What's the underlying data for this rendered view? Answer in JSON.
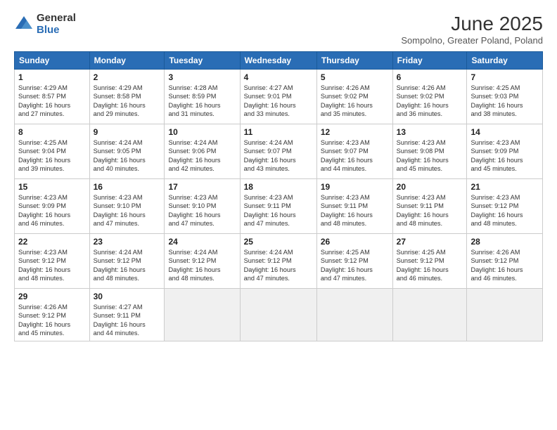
{
  "header": {
    "logo_general": "General",
    "logo_blue": "Blue",
    "month_year": "June 2025",
    "location": "Sompolno, Greater Poland, Poland"
  },
  "weekdays": [
    "Sunday",
    "Monday",
    "Tuesday",
    "Wednesday",
    "Thursday",
    "Friday",
    "Saturday"
  ],
  "weeks": [
    [
      {
        "day": "1",
        "info": "Sunrise: 4:29 AM\nSunset: 8:57 PM\nDaylight: 16 hours\nand 27 minutes."
      },
      {
        "day": "2",
        "info": "Sunrise: 4:29 AM\nSunset: 8:58 PM\nDaylight: 16 hours\nand 29 minutes."
      },
      {
        "day": "3",
        "info": "Sunrise: 4:28 AM\nSunset: 8:59 PM\nDaylight: 16 hours\nand 31 minutes."
      },
      {
        "day": "4",
        "info": "Sunrise: 4:27 AM\nSunset: 9:01 PM\nDaylight: 16 hours\nand 33 minutes."
      },
      {
        "day": "5",
        "info": "Sunrise: 4:26 AM\nSunset: 9:02 PM\nDaylight: 16 hours\nand 35 minutes."
      },
      {
        "day": "6",
        "info": "Sunrise: 4:26 AM\nSunset: 9:02 PM\nDaylight: 16 hours\nand 36 minutes."
      },
      {
        "day": "7",
        "info": "Sunrise: 4:25 AM\nSunset: 9:03 PM\nDaylight: 16 hours\nand 38 minutes."
      }
    ],
    [
      {
        "day": "8",
        "info": "Sunrise: 4:25 AM\nSunset: 9:04 PM\nDaylight: 16 hours\nand 39 minutes."
      },
      {
        "day": "9",
        "info": "Sunrise: 4:24 AM\nSunset: 9:05 PM\nDaylight: 16 hours\nand 40 minutes."
      },
      {
        "day": "10",
        "info": "Sunrise: 4:24 AM\nSunset: 9:06 PM\nDaylight: 16 hours\nand 42 minutes."
      },
      {
        "day": "11",
        "info": "Sunrise: 4:24 AM\nSunset: 9:07 PM\nDaylight: 16 hours\nand 43 minutes."
      },
      {
        "day": "12",
        "info": "Sunrise: 4:23 AM\nSunset: 9:07 PM\nDaylight: 16 hours\nand 44 minutes."
      },
      {
        "day": "13",
        "info": "Sunrise: 4:23 AM\nSunset: 9:08 PM\nDaylight: 16 hours\nand 45 minutes."
      },
      {
        "day": "14",
        "info": "Sunrise: 4:23 AM\nSunset: 9:09 PM\nDaylight: 16 hours\nand 45 minutes."
      }
    ],
    [
      {
        "day": "15",
        "info": "Sunrise: 4:23 AM\nSunset: 9:09 PM\nDaylight: 16 hours\nand 46 minutes."
      },
      {
        "day": "16",
        "info": "Sunrise: 4:23 AM\nSunset: 9:10 PM\nDaylight: 16 hours\nand 47 minutes."
      },
      {
        "day": "17",
        "info": "Sunrise: 4:23 AM\nSunset: 9:10 PM\nDaylight: 16 hours\nand 47 minutes."
      },
      {
        "day": "18",
        "info": "Sunrise: 4:23 AM\nSunset: 9:11 PM\nDaylight: 16 hours\nand 47 minutes."
      },
      {
        "day": "19",
        "info": "Sunrise: 4:23 AM\nSunset: 9:11 PM\nDaylight: 16 hours\nand 48 minutes."
      },
      {
        "day": "20",
        "info": "Sunrise: 4:23 AM\nSunset: 9:11 PM\nDaylight: 16 hours\nand 48 minutes."
      },
      {
        "day": "21",
        "info": "Sunrise: 4:23 AM\nSunset: 9:12 PM\nDaylight: 16 hours\nand 48 minutes."
      }
    ],
    [
      {
        "day": "22",
        "info": "Sunrise: 4:23 AM\nSunset: 9:12 PM\nDaylight: 16 hours\nand 48 minutes."
      },
      {
        "day": "23",
        "info": "Sunrise: 4:24 AM\nSunset: 9:12 PM\nDaylight: 16 hours\nand 48 minutes."
      },
      {
        "day": "24",
        "info": "Sunrise: 4:24 AM\nSunset: 9:12 PM\nDaylight: 16 hours\nand 48 minutes."
      },
      {
        "day": "25",
        "info": "Sunrise: 4:24 AM\nSunset: 9:12 PM\nDaylight: 16 hours\nand 47 minutes."
      },
      {
        "day": "26",
        "info": "Sunrise: 4:25 AM\nSunset: 9:12 PM\nDaylight: 16 hours\nand 47 minutes."
      },
      {
        "day": "27",
        "info": "Sunrise: 4:25 AM\nSunset: 9:12 PM\nDaylight: 16 hours\nand 46 minutes."
      },
      {
        "day": "28",
        "info": "Sunrise: 4:26 AM\nSunset: 9:12 PM\nDaylight: 16 hours\nand 46 minutes."
      }
    ],
    [
      {
        "day": "29",
        "info": "Sunrise: 4:26 AM\nSunset: 9:12 PM\nDaylight: 16 hours\nand 45 minutes."
      },
      {
        "day": "30",
        "info": "Sunrise: 4:27 AM\nSunset: 9:11 PM\nDaylight: 16 hours\nand 44 minutes."
      },
      null,
      null,
      null,
      null,
      null
    ]
  ]
}
